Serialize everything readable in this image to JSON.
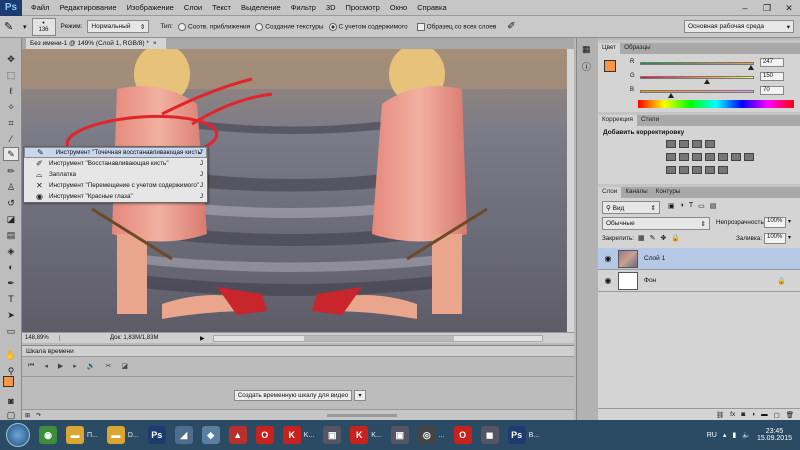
{
  "app": {
    "logo": "Ps"
  },
  "menu": [
    "Файл",
    "Редактирование",
    "Изображение",
    "Слои",
    "Текст",
    "Выделение",
    "Фильтр",
    "3D",
    "Просмотр",
    "Окно",
    "Справка"
  ],
  "window_controls": [
    "–",
    "❐",
    "✕"
  ],
  "options": {
    "brush_size": "136",
    "mode_label": "Режим:",
    "mode_value": "Нормальный",
    "type_label": "Тип:",
    "type_options": [
      "Соотв. приближения",
      "Создание текстуры",
      "С учетом содержимого"
    ],
    "type_selected_index": 2,
    "sample_all_layers": "Образец со всех слоев",
    "workspace": "Основная рабочая среда"
  },
  "document": {
    "tab_title": "Без имени-1 @ 149% (Слой 1, RGB/8) *",
    "tab_close": "×",
    "zoom": "148,89%",
    "doc_info": "Док: 1,83M/1,83M"
  },
  "tool_flyout": [
    {
      "label": "Инструмент \"Точечная восстанавливающая кисть\"",
      "key": "J",
      "icon": "spot-heal-icon",
      "selected": true
    },
    {
      "label": "Инструмент \"Восстанавливающая кисть\"",
      "key": "J",
      "icon": "heal-brush-icon",
      "selected": false
    },
    {
      "label": "Заплатка",
      "key": "J",
      "icon": "patch-icon",
      "selected": false
    },
    {
      "label": "Инструмент \"Перемещение с учетом содержимого\"",
      "key": "J",
      "icon": "content-move-icon",
      "selected": false
    },
    {
      "label": "Инструмент \"Красные глаза\"",
      "key": "J",
      "icon": "red-eye-icon",
      "selected": false
    }
  ],
  "timeline": {
    "title": "Шкала времени",
    "create_button": "Создать временную шкалу для видео"
  },
  "color_panel": {
    "tabs": [
      "Цвет",
      "Образцы"
    ],
    "channels": [
      {
        "label": "R",
        "value": "247",
        "fraction": 0.97
      },
      {
        "label": "G",
        "value": "150",
        "fraction": 0.59
      },
      {
        "label": "B",
        "value": "70",
        "fraction": 0.27
      }
    ],
    "foreground": "#f79646"
  },
  "adjust_panel": {
    "tabs": [
      "Коррекция",
      "Стили"
    ],
    "title": "Добавить корректировку"
  },
  "layers_panel": {
    "tabs": [
      "Слои",
      "Каналы",
      "Контуры"
    ],
    "kind": "Вид",
    "blend_mode": "Обычные",
    "opacity_label": "Непрозрачность:",
    "opacity": "100%",
    "lock_label": "Закрепить:",
    "fill_label": "Заливка:",
    "fill": "100%",
    "layers": [
      {
        "name": "Слой 1",
        "selected": true
      },
      {
        "name": "Фон",
        "selected": false
      }
    ]
  },
  "taskbar": {
    "items": [
      {
        "label": "",
        "icon": "chrome-icon",
        "color": "#3b8f3b",
        "glyph": "◉"
      },
      {
        "label": "П...",
        "icon": "folder-icon",
        "color": "#d9a632",
        "glyph": "▬"
      },
      {
        "label": "D...",
        "icon": "folder-icon",
        "color": "#d9a632",
        "glyph": "▬"
      },
      {
        "label": "",
        "icon": "photoshop-icon",
        "color": "#1d3b6e",
        "glyph": "Ps"
      },
      {
        "label": "",
        "icon": "app-icon",
        "color": "#4f6d8f",
        "glyph": "◢"
      },
      {
        "label": "",
        "icon": "app-icon",
        "color": "#5a7fa0",
        "glyph": "◆"
      },
      {
        "label": "",
        "icon": "acrobat-icon",
        "color": "#b8302b",
        "glyph": "▲"
      },
      {
        "label": "",
        "icon": "opera-icon",
        "color": "#c8221d",
        "glyph": "O"
      },
      {
        "label": "K...",
        "icon": "k-icon",
        "color": "#c8221d",
        "glyph": "K"
      },
      {
        "label": "",
        "icon": "app-icon",
        "color": "#556",
        "glyph": "▣"
      },
      {
        "label": "K...",
        "icon": "k-icon",
        "color": "#c8221d",
        "glyph": "K"
      },
      {
        "label": "",
        "icon": "app-icon",
        "color": "#556",
        "glyph": "▣"
      },
      {
        "label": "...",
        "icon": "player-icon",
        "color": "#444",
        "glyph": "◎"
      },
      {
        "label": "",
        "icon": "opera-icon",
        "color": "#c8221d",
        "glyph": "O"
      },
      {
        "label": "",
        "icon": "app-icon",
        "color": "#556",
        "glyph": "◼"
      },
      {
        "label": "В...",
        "icon": "photoshop-icon",
        "color": "#1d3b6e",
        "glyph": "Ps"
      }
    ],
    "lang": "RU",
    "time": "23:45",
    "date": "15.09.2015"
  }
}
